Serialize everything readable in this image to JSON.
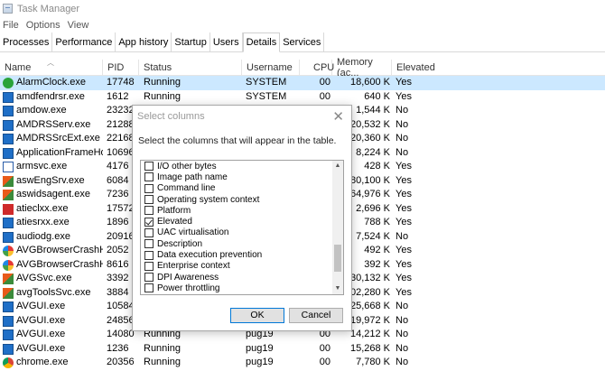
{
  "window": {
    "title": "Task Manager"
  },
  "menu": [
    "File",
    "Options",
    "View"
  ],
  "tabs": [
    {
      "label": "Processes",
      "active": false
    },
    {
      "label": "Performance",
      "active": false
    },
    {
      "label": "App history",
      "active": false
    },
    {
      "label": "Startup",
      "active": false
    },
    {
      "label": "Users",
      "active": false
    },
    {
      "label": "Details",
      "active": true
    },
    {
      "label": "Services",
      "active": false
    }
  ],
  "columns": {
    "name": "Name",
    "pid": "PID",
    "status": "Status",
    "username": "Username",
    "cpu": "CPU",
    "memory": "Memory (ac...",
    "elevated": "Elevated"
  },
  "processes": [
    {
      "name": "AlarmClock.exe",
      "pid": "17748",
      "status": "Running",
      "user": "SYSTEM",
      "cpu": "00",
      "mem": "18,600 K",
      "elev": "Yes",
      "icon": "alarm-clock-icon",
      "selected": true
    },
    {
      "name": "amdfendrsr.exe",
      "pid": "1612",
      "status": "Running",
      "user": "SYSTEM",
      "cpu": "00",
      "mem": "640 K",
      "elev": "Yes",
      "icon": "amd-icon"
    },
    {
      "name": "amdow.exe",
      "pid": "23232",
      "status": "",
      "user": "",
      "cpu": "",
      "mem": "1,544 K",
      "elev": "No",
      "icon": "amd-icon"
    },
    {
      "name": "AMDRSServ.exe",
      "pid": "21288",
      "status": "",
      "user": "",
      "cpu": "",
      "mem": "20,532 K",
      "elev": "No",
      "icon": "amd-icon"
    },
    {
      "name": "AMDRSSrcExt.exe",
      "pid": "22168",
      "status": "",
      "user": "",
      "cpu": "",
      "mem": "20,360 K",
      "elev": "No",
      "icon": "amd-icon"
    },
    {
      "name": "ApplicationFrameHo...",
      "pid": "10696",
      "status": "",
      "user": "",
      "cpu": "",
      "mem": "8,224 K",
      "elev": "No",
      "icon": "amd-icon"
    },
    {
      "name": "armsvc.exe",
      "pid": "4176",
      "status": "",
      "user": "",
      "cpu": "",
      "mem": "428 K",
      "elev": "Yes",
      "icon": "window-icon"
    },
    {
      "name": "aswEngSrv.exe",
      "pid": "6084",
      "status": "",
      "user": "",
      "cpu": "",
      "mem": "80,100 K",
      "elev": "Yes",
      "icon": "avast-icon"
    },
    {
      "name": "aswidsagent.exe",
      "pid": "7236",
      "status": "",
      "user": "",
      "cpu": "",
      "mem": "64,976 K",
      "elev": "Yes",
      "icon": "avast-icon"
    },
    {
      "name": "atieclxx.exe",
      "pid": "17572",
      "status": "",
      "user": "",
      "cpu": "",
      "mem": "2,696 K",
      "elev": "Yes",
      "icon": "ati-icon"
    },
    {
      "name": "atiesrxx.exe",
      "pid": "1896",
      "status": "",
      "user": "",
      "cpu": "",
      "mem": "788 K",
      "elev": "Yes",
      "icon": "amd-icon"
    },
    {
      "name": "audiodg.exe",
      "pid": "20916",
      "status": "",
      "user": "",
      "cpu": "",
      "mem": "7,524 K",
      "elev": "No",
      "icon": "amd-icon"
    },
    {
      "name": "AVGBrowserCrashHa...",
      "pid": "2052",
      "status": "",
      "user": "",
      "cpu": "",
      "mem": "492 K",
      "elev": "Yes",
      "icon": "avg-icon"
    },
    {
      "name": "AVGBrowserCrashHa...",
      "pid": "8616",
      "status": "",
      "user": "",
      "cpu": "",
      "mem": "392 K",
      "elev": "Yes",
      "icon": "avg-icon"
    },
    {
      "name": "AVGSvc.exe",
      "pid": "3392",
      "status": "",
      "user": "",
      "cpu": "",
      "mem": "30,132 K",
      "elev": "Yes",
      "icon": "avast-icon"
    },
    {
      "name": "avgToolsSvc.exe",
      "pid": "3884",
      "status": "",
      "user": "",
      "cpu": "",
      "mem": "102,280 K",
      "elev": "Yes",
      "icon": "avast-icon"
    },
    {
      "name": "AVGUI.exe",
      "pid": "10584",
      "status": "",
      "user": "",
      "cpu": "",
      "mem": "25,668 K",
      "elev": "No",
      "icon": "avg-ui-icon"
    },
    {
      "name": "AVGUI.exe",
      "pid": "24856",
      "status": "",
      "user": "",
      "cpu": "",
      "mem": "19,972 K",
      "elev": "No",
      "icon": "avg-ui-icon"
    },
    {
      "name": "AVGUI.exe",
      "pid": "14080",
      "status": "Running",
      "user": "pug19",
      "cpu": "00",
      "mem": "14,212 K",
      "elev": "No",
      "icon": "avg-ui-icon"
    },
    {
      "name": "AVGUI.exe",
      "pid": "1236",
      "status": "Running",
      "user": "pug19",
      "cpu": "00",
      "mem": "15,268 K",
      "elev": "No",
      "icon": "avg-ui-icon"
    },
    {
      "name": "chrome.exe",
      "pid": "20356",
      "status": "Running",
      "user": "pug19",
      "cpu": "00",
      "mem": "7,780 K",
      "elev": "No",
      "icon": "chrome-icon"
    }
  ],
  "dialog": {
    "title": "Select columns",
    "instruction": "Select the columns that will appear in the table.",
    "options": [
      {
        "label": "I/O other bytes",
        "checked": false
      },
      {
        "label": "Image path name",
        "checked": false
      },
      {
        "label": "Command line",
        "checked": false
      },
      {
        "label": "Operating system context",
        "checked": false
      },
      {
        "label": "Platform",
        "checked": false
      },
      {
        "label": "Elevated",
        "checked": true
      },
      {
        "label": "UAC virtualisation",
        "checked": false
      },
      {
        "label": "Description",
        "checked": false
      },
      {
        "label": "Data execution prevention",
        "checked": false
      },
      {
        "label": "Enterprise context",
        "checked": false
      },
      {
        "label": "DPI Awareness",
        "checked": false
      },
      {
        "label": "Power throttling",
        "checked": false
      }
    ],
    "ok_label": "OK",
    "cancel_label": "Cancel"
  }
}
